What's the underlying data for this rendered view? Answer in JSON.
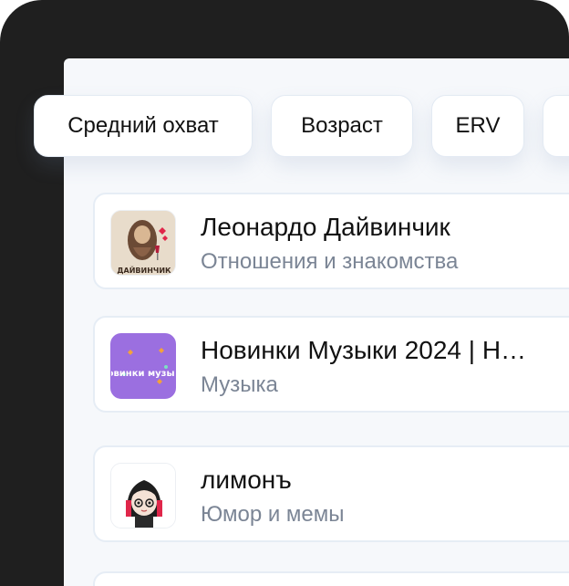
{
  "filters": [
    {
      "label": "Средний охват"
    },
    {
      "label": "Возраст"
    },
    {
      "label": "ERV"
    },
    {
      "label": ""
    }
  ],
  "channels": [
    {
      "title": "Леонардо Дайвинчик",
      "category": "Отношения и знакомства",
      "avatar_text": "ДАЙВИНЧИК",
      "avatar_icon": "leonardo-avatar-icon"
    },
    {
      "title": "Новинки Музыки 2024 | Н…",
      "category": "Музыка",
      "avatar_text": "новинки музыки",
      "avatar_icon": "music-news-avatar-icon"
    },
    {
      "title": "лимонъ",
      "category": "Юмор и мемы",
      "avatar_icon": "girl-avatar-icon"
    }
  ],
  "colors": {
    "frame": "#1f1f1f",
    "screen": "#f6f8fb",
    "card_border": "#e6edf5",
    "muted_text": "#7b8595",
    "music_avatar_bg": "#9b6fe0"
  }
}
